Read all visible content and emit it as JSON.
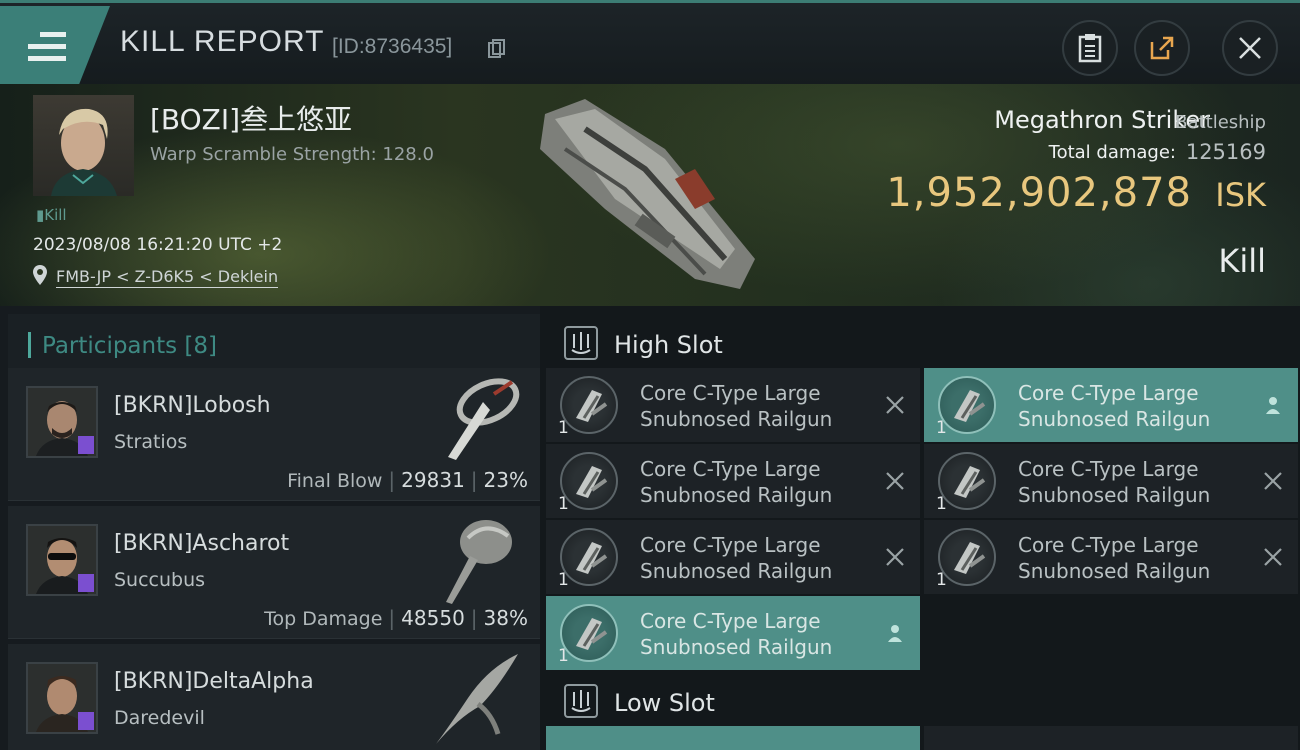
{
  "header": {
    "title": "KILL REPORT",
    "report_id": "[ID:8736435]"
  },
  "victim": {
    "name": "[BOZI]叁上悠亚",
    "warp_scramble": "Warp Scramble Strength: 128.0",
    "kill_tag": "Kill",
    "datetime": "2023/08/08 16:21:20 UTC +2",
    "location": "FMB-JP < Z-D6K5 < Deklein"
  },
  "ship": {
    "name": "Megathron Striker",
    "class": "Battleship",
    "total_damage_label": "Total damage:",
    "total_damage": "125169",
    "isk_value": "1,952,902,878",
    "isk_unit": "ISK",
    "result": "Kill"
  },
  "participants": {
    "title": "Participants [8]",
    "rows": [
      {
        "name": "[BKRN]Lobosh",
        "ship": "Stratios",
        "stat_label": "Final Blow",
        "damage": "29831",
        "percent": "23%"
      },
      {
        "name": "[BKRN]Ascharot",
        "ship": "Succubus",
        "stat_label": "Top Damage",
        "damage": "48550",
        "percent": "38%"
      },
      {
        "name": "[BKRN]DeltaAlpha",
        "ship": "Daredevil",
        "stat_label": "",
        "damage": "",
        "percent": ""
      }
    ]
  },
  "high_slot": {
    "title": "High Slot",
    "modules": [
      {
        "name_line1": "Core C-Type Large",
        "name_line2": "Snubnosed Railgun",
        "qty": "1",
        "status": "destroyed"
      },
      {
        "name_line1": "Core C-Type Large",
        "name_line2": "Snubnosed Railgun",
        "qty": "1",
        "status": "destroyed"
      },
      {
        "name_line1": "Core C-Type Large",
        "name_line2": "Snubnosed Railgun",
        "qty": "1",
        "status": "destroyed"
      },
      {
        "name_line1": "Core C-Type Large",
        "name_line2": "Snubnosed Railgun",
        "qty": "1",
        "status": "dropped"
      },
      {
        "name_line1": "Core C-Type Large",
        "name_line2": "Snubnosed Railgun",
        "qty": "1",
        "status": "dropped"
      },
      {
        "name_line1": "Core C-Type Large",
        "name_line2": "Snubnosed Railgun",
        "qty": "1",
        "status": "destroyed"
      },
      {
        "name_line1": "Core C-Type Large",
        "name_line2": "Snubnosed Railgun",
        "qty": "1",
        "status": "destroyed"
      }
    ]
  },
  "low_slot": {
    "title": "Low Slot"
  },
  "colors": {
    "accent": "#3b7f78",
    "isk_gold": "#e8c77e",
    "dropped_bg": "#4f8f88",
    "badge_purple": "#7b4fd0"
  }
}
